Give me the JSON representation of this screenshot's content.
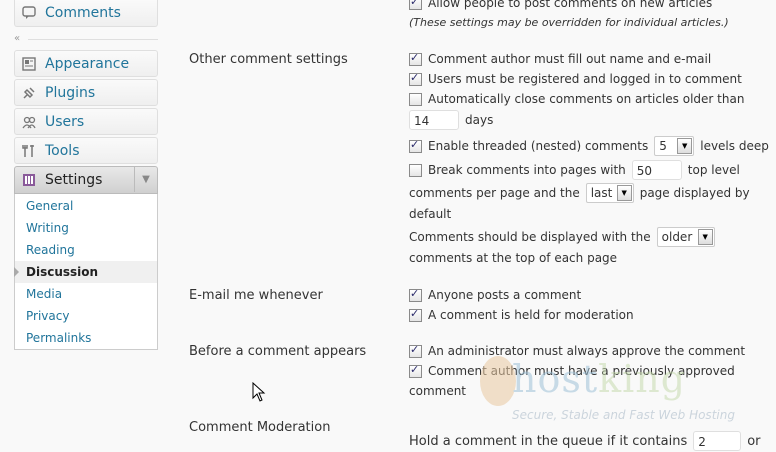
{
  "sidebar": {
    "top_item": {
      "label": "Comments",
      "icon": "comments-icon"
    },
    "collapse_icon": "«",
    "items": [
      {
        "label": "Appearance",
        "icon": "appearance-icon"
      },
      {
        "label": "Plugins",
        "icon": "plugins-icon"
      },
      {
        "label": "Users",
        "icon": "users-icon"
      },
      {
        "label": "Tools",
        "icon": "tools-icon"
      },
      {
        "label": "Settings",
        "icon": "settings-icon"
      }
    ],
    "settings_arrow": "▼",
    "submenu": [
      "General",
      "Writing",
      "Reading",
      "Discussion",
      "Media",
      "Privacy",
      "Permalinks"
    ],
    "current_submenu": "Discussion"
  },
  "settings": {
    "top": {
      "allow_post": "Allow people to post comments on new articles",
      "override_note": "(These settings may be overridden for individual articles.)"
    },
    "other": {
      "heading": "Other comment settings",
      "author_fill": "Comment author must fill out name and e-mail",
      "registered": "Users must be registered and logged in to comment",
      "auto_close": "Automatically close comments on articles older than",
      "auto_close_days": "14",
      "days_label": "days",
      "threaded": "Enable threaded (nested) comments",
      "threaded_levels": "5",
      "levels_deep": "levels deep",
      "break_pages": "Break comments into pages with",
      "per_page_value": "50",
      "top_level": "top level",
      "comments_per_page": "comments per page and the",
      "page_select": "last",
      "page_displayed": "page displayed by",
      "default_label": "default",
      "display_with": "Comments should be displayed with the",
      "order_select": "older",
      "at_top": "comments at the top of each page"
    },
    "email": {
      "heading": "E-mail me whenever",
      "anyone_posts": "Anyone posts a comment",
      "held_moderation": "A comment is held for moderation"
    },
    "before": {
      "heading": "Before a comment appears",
      "admin_approve": "An administrator must always approve the comment",
      "author_previous": "Comment author must have a previously approved",
      "comment_word": "comment"
    },
    "moderation": {
      "heading": "Comment Moderation",
      "hold_queue": "Hold a comment in the queue if it contains",
      "links_value": "2",
      "or_word": "or"
    }
  },
  "watermark": {
    "brand_a": "host",
    "brand_b": "king",
    "tagline": "Secure, Stable and Fast Web Hosting"
  }
}
